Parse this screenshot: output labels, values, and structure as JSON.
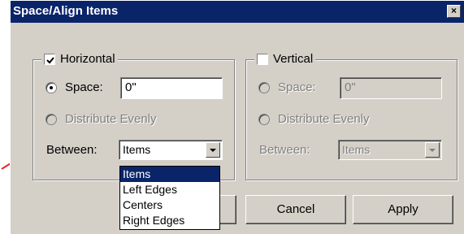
{
  "window": {
    "title": "Space/Align Items",
    "close_glyph": "×"
  },
  "horizontal": {
    "label": "Horizontal",
    "checked": true,
    "space_label": "Space:",
    "space_value": "0\"",
    "distribute_label": "Distribute Evenly",
    "between_label": "Between:",
    "between_value": "Items"
  },
  "vertical": {
    "label": "Vertical",
    "checked": false,
    "space_label": "Space:",
    "space_value": "0\"",
    "distribute_label": "Distribute Evenly",
    "between_label": "Between:",
    "between_value": "Items"
  },
  "dropdown_options": [
    "Items",
    "Left Edges",
    "Centers",
    "Right Edges"
  ],
  "buttons": {
    "cancel": "Cancel",
    "apply": "Apply"
  },
  "colors": {
    "titlebar": "#0a246a",
    "dialog_bg": "#d4d0c8",
    "arrow": "#e8271c",
    "highlight": "#0a246a"
  }
}
